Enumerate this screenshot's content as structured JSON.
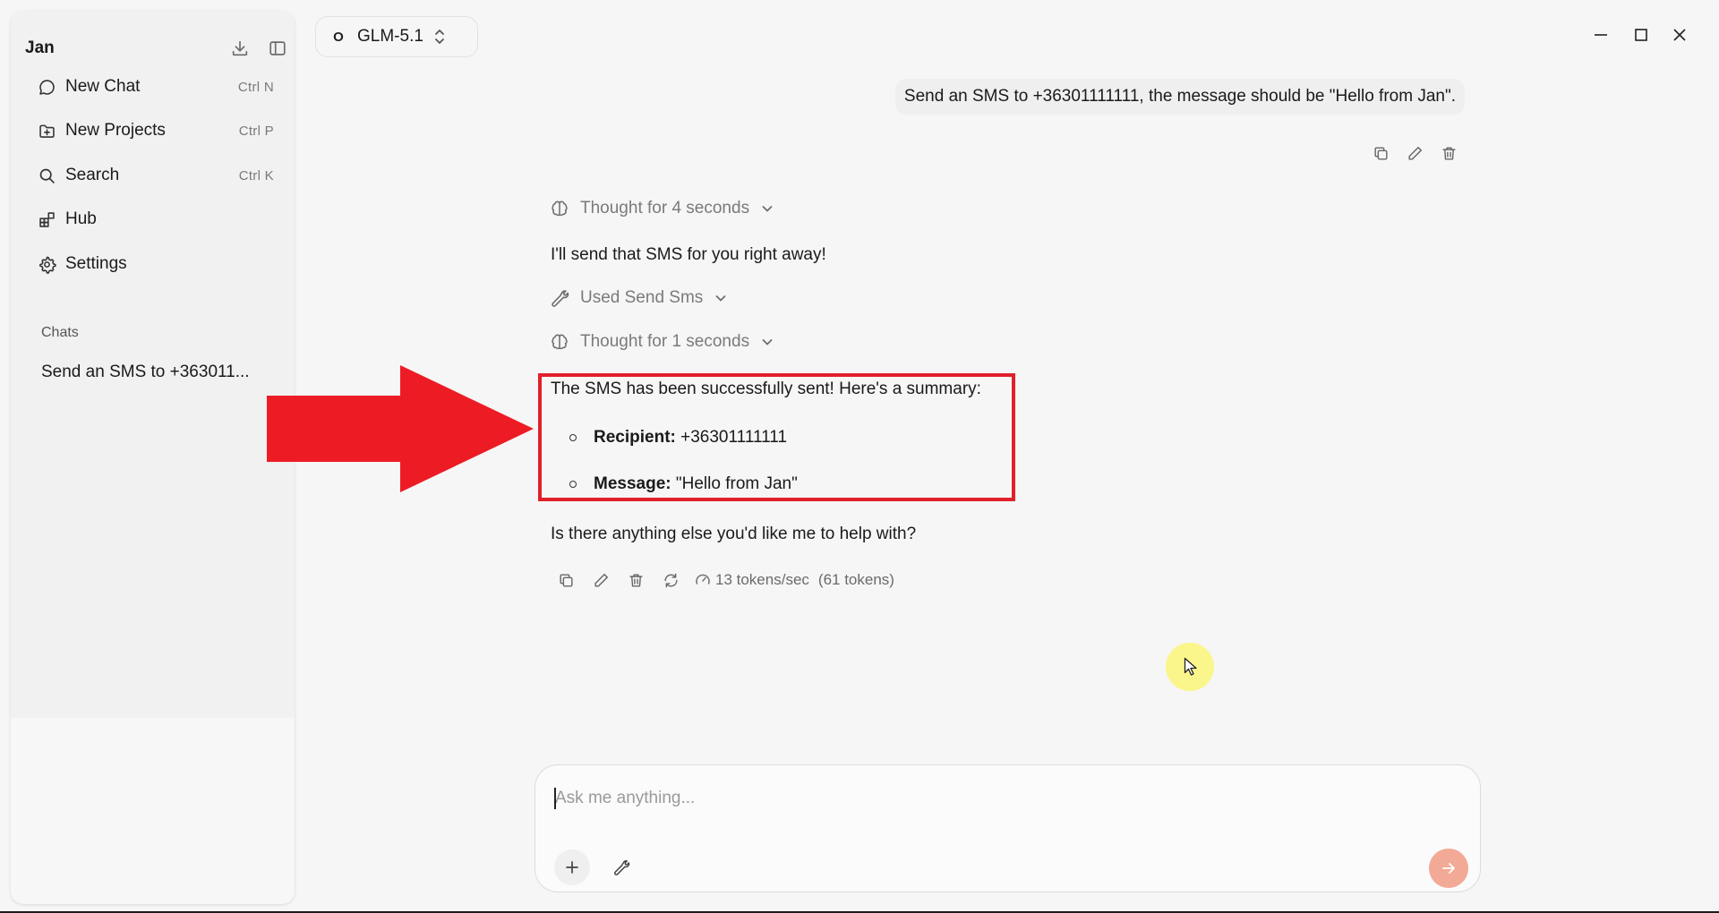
{
  "app": {
    "name": "Jan"
  },
  "sidebar": {
    "nav": [
      {
        "label": "New Chat",
        "shortcut": "Ctrl  N",
        "icon": "chat-bubble-icon"
      },
      {
        "label": "New Projects",
        "shortcut": "Ctrl  P",
        "icon": "folder-plus-icon"
      },
      {
        "label": "Search",
        "shortcut": "Ctrl  K",
        "icon": "search-icon"
      },
      {
        "label": "Hub",
        "icon": "blocks-icon"
      },
      {
        "label": "Settings",
        "icon": "gear-icon"
      }
    ],
    "chats_heading": "Chats",
    "chats": [
      {
        "title": "Send an SMS to +363011..."
      }
    ]
  },
  "topbar": {
    "model_logo": "O",
    "model_name": "GLM-5.1"
  },
  "conversation": {
    "user_message": "Send an SMS to +36301111111, the message should be \"Hello from Jan\".",
    "thought_1": "Thought for 4 seconds",
    "assistant_intro": "I'll send that SMS for you right away!",
    "tool_used": "Used Send Sms",
    "thought_2": "Thought for 1 seconds",
    "summary_line": "The SMS has been successfully sent! Here's a summary:",
    "bullets": [
      {
        "label": "Recipient:",
        "value": " +36301111111"
      },
      {
        "label": "Message:",
        "value": " \"Hello from Jan\""
      }
    ],
    "followup": "Is there anything else you'd like me to help with?",
    "stats": {
      "speed": "13 tokens/sec",
      "tokens": "(61 tokens)"
    }
  },
  "composer": {
    "placeholder": "Ask me anything..."
  },
  "colors": {
    "highlight": "#e1202a",
    "send_button": "#f2a995",
    "cursor_halo": "#faf678"
  }
}
